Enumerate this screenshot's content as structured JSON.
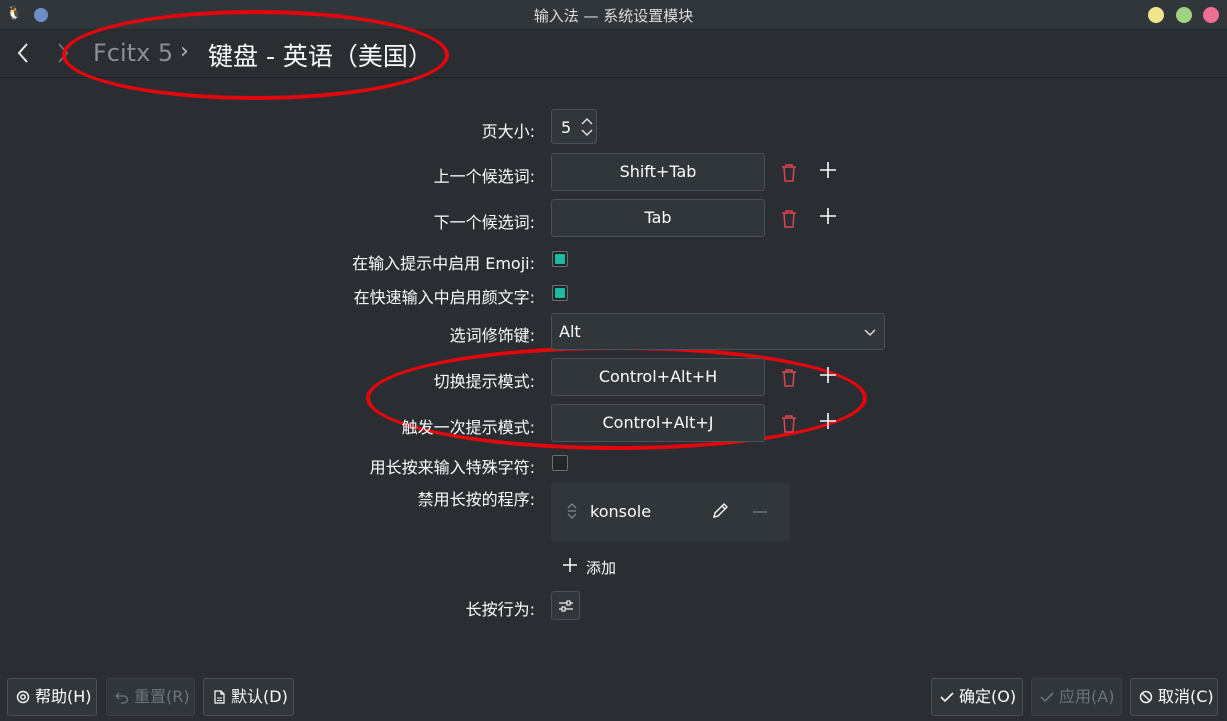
{
  "window": {
    "title": "输入法 — 系统设置模块",
    "app_icon": "tux-penguin-icon",
    "buttons": [
      "minimize",
      "maximize",
      "close"
    ]
  },
  "header": {
    "back_icon": "chevron-left-icon",
    "forward_icon": "chevron-right-icon",
    "breadcrumb_parent": "Fcitx 5",
    "breadcrumb_separator": "›",
    "breadcrumb_current": "键盘 - 英语（美国）"
  },
  "form": {
    "page_size": {
      "label": "页大小:",
      "value": "5"
    },
    "prev_candidate": {
      "label": "上一个候选词:",
      "value": "Shift+Tab"
    },
    "next_candidate": {
      "label": "下一个候选词:",
      "value": "Tab"
    },
    "emoji_hint": {
      "label": "在输入提示中启用 Emoji:",
      "checked": true
    },
    "quickphrase_kaomoji": {
      "label": "在快速输入中启用颜文字:",
      "checked": true
    },
    "candidate_modifier": {
      "label": "选词修饰键:",
      "value": "Alt"
    },
    "toggle_hint_mode": {
      "label": "切换提示模式:",
      "value": "Control+Alt+H"
    },
    "trigger_hint_once": {
      "label": "触发一次提示模式:",
      "value": "Control+Alt+J"
    },
    "long_press_special": {
      "label": "用长按来输入特殊字符:",
      "checked": false
    },
    "long_press_blocklist": {
      "label": "禁用长按的程序:",
      "items": [
        "konsole"
      ],
      "add_label": "添加"
    },
    "long_press_behavior": {
      "label": "长按行为:"
    }
  },
  "footer": {
    "help": "帮助(H)",
    "reset": "重置(R)",
    "defaults": "默认(D)",
    "ok": "确定(O)",
    "apply": "应用(A)",
    "cancel": "取消(C)"
  },
  "colors": {
    "background": "#2a2e32",
    "accent_checkbox": "#1abc9c",
    "delete_icon": "#da4453",
    "annotation": "#e3060d"
  }
}
